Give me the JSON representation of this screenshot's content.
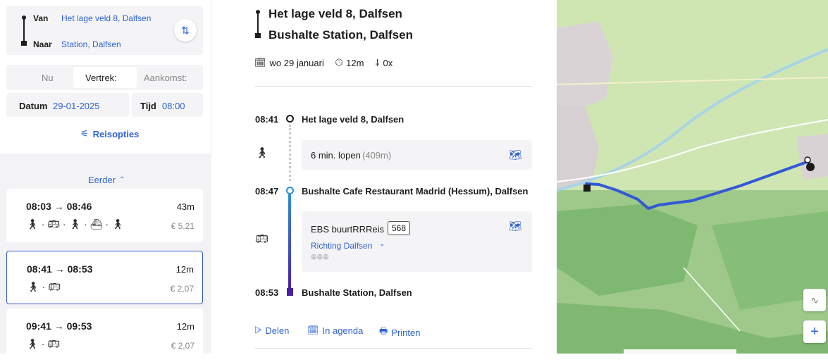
{
  "planner": {
    "from_label": "Van",
    "from_value": "Het lage veld 8, Dalfsen",
    "to_label": "Naar",
    "to_value": "Station, Dalfsen",
    "mode_now": "Nu",
    "mode_depart": "Vertrek:",
    "mode_arrive": "Aankomst:",
    "date_label": "Datum",
    "date_value": "29-01-2025",
    "time_label": "Tijd",
    "time_value": "08:00",
    "options_label": "Reisopties",
    "earlier_label": "Eerder"
  },
  "trips": [
    {
      "times": "08:03 → 08:46",
      "duration": "43m",
      "price": "€ 5,21"
    },
    {
      "times": "08:41 → 08:53",
      "duration": "12m",
      "price": "€ 2,07"
    },
    {
      "times": "09:41 → 09:53",
      "duration": "12m",
      "price": "€ 2,07"
    }
  ],
  "detail": {
    "origin": "Het lage veld 8, Dalfsen",
    "destination": "Bushalte Station, Dalfsen",
    "date": "wo 29 januari",
    "duration": "12m",
    "transfers": "0x",
    "stops": [
      {
        "time": "08:41",
        "name": "Het lage veld 8, Dalfsen"
      },
      {
        "time": "08:47",
        "name": "Bushalte Cafe Restaurant Madrid (Hessum), Dalfsen"
      },
      {
        "time": "08:53",
        "name": "Bushalte Station, Dalfsen"
      }
    ],
    "walk_text": "6 min. lopen",
    "walk_distance": "(409m)",
    "bus_operator": "EBS buurtRRReis",
    "bus_line": "568",
    "bus_direction": "Richting Dalfsen",
    "share_label": "Delen",
    "calendar_label": "In agenda",
    "print_label": "Printen"
  },
  "colors": {
    "accent": "#2d62d6",
    "route": "#3358d4",
    "line_start": "#2f8fd6",
    "line_end": "#4a1fa8"
  }
}
